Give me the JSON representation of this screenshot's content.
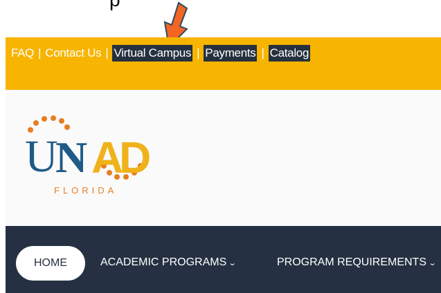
{
  "top_caption": "p",
  "topbar": {
    "links": [
      {
        "label": "FAQ",
        "boxed": false
      },
      {
        "label": "Contact Us",
        "boxed": false
      },
      {
        "label": "Virtual Campus",
        "boxed": true
      },
      {
        "label": "Payments",
        "boxed": true
      },
      {
        "label": "Catalog",
        "boxed": true
      }
    ],
    "separator": "|",
    "color": "#f7b400"
  },
  "logo": {
    "letters": [
      "U",
      "N",
      "A",
      "D"
    ],
    "subtitle": "FLORIDA",
    "colors": {
      "blue": "#1f5b87",
      "gold": "#f0b21a",
      "orange": "#e67e22"
    }
  },
  "nav": {
    "home": "HOME",
    "items": [
      {
        "label": "ACADEMIC PROGRAMS",
        "icon": "chevron-down-icon"
      },
      {
        "label": "PROGRAM REQUIREMENTS",
        "icon": "chevron-down-icon"
      }
    ],
    "color": "#253142"
  },
  "annotation": {
    "icon": "arrow-down-icon",
    "color": "#f26522"
  }
}
